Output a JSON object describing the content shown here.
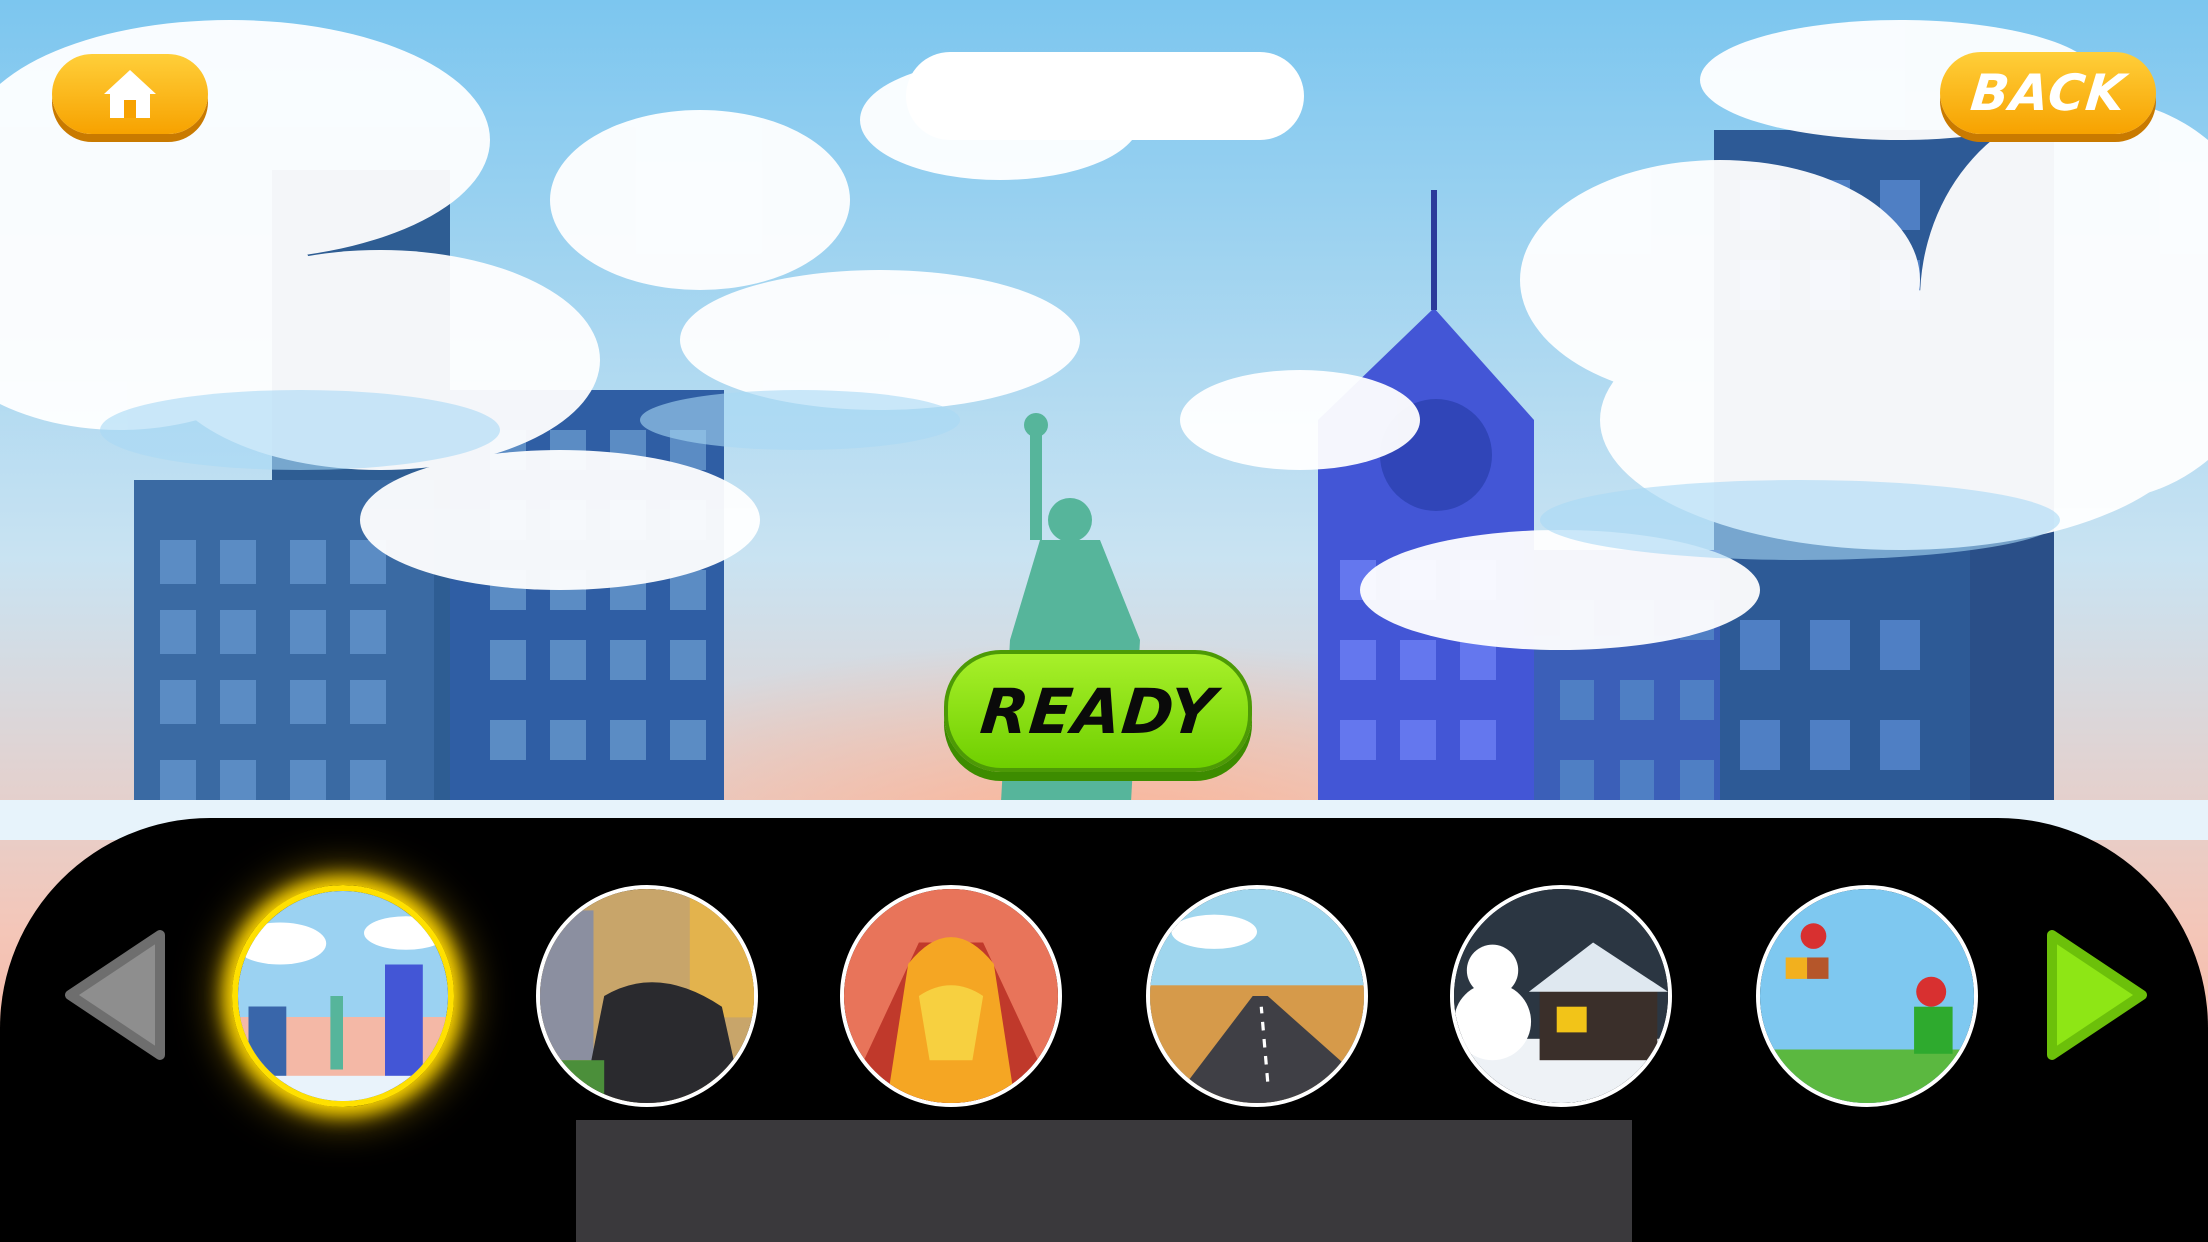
{
  "buttons": {
    "home_icon": "home-icon",
    "back_label": "BACK",
    "ready_label": "READY"
  },
  "colors": {
    "accent_orange": "#f7a200",
    "ready_green": "#8ee615",
    "selection_glow": "#ffd800",
    "tray": "#000000"
  },
  "level_selector": {
    "prev_icon": "arrow-left-icon",
    "next_icon": "arrow-right-icon",
    "selected_index": 0,
    "levels": [
      {
        "theme": "city-statue-of-liberty"
      },
      {
        "theme": "city-panther"
      },
      {
        "theme": "volcano-lava"
      },
      {
        "theme": "desert-road"
      },
      {
        "theme": "snow-house-snowman"
      },
      {
        "theme": "plumber-pipes"
      }
    ]
  }
}
